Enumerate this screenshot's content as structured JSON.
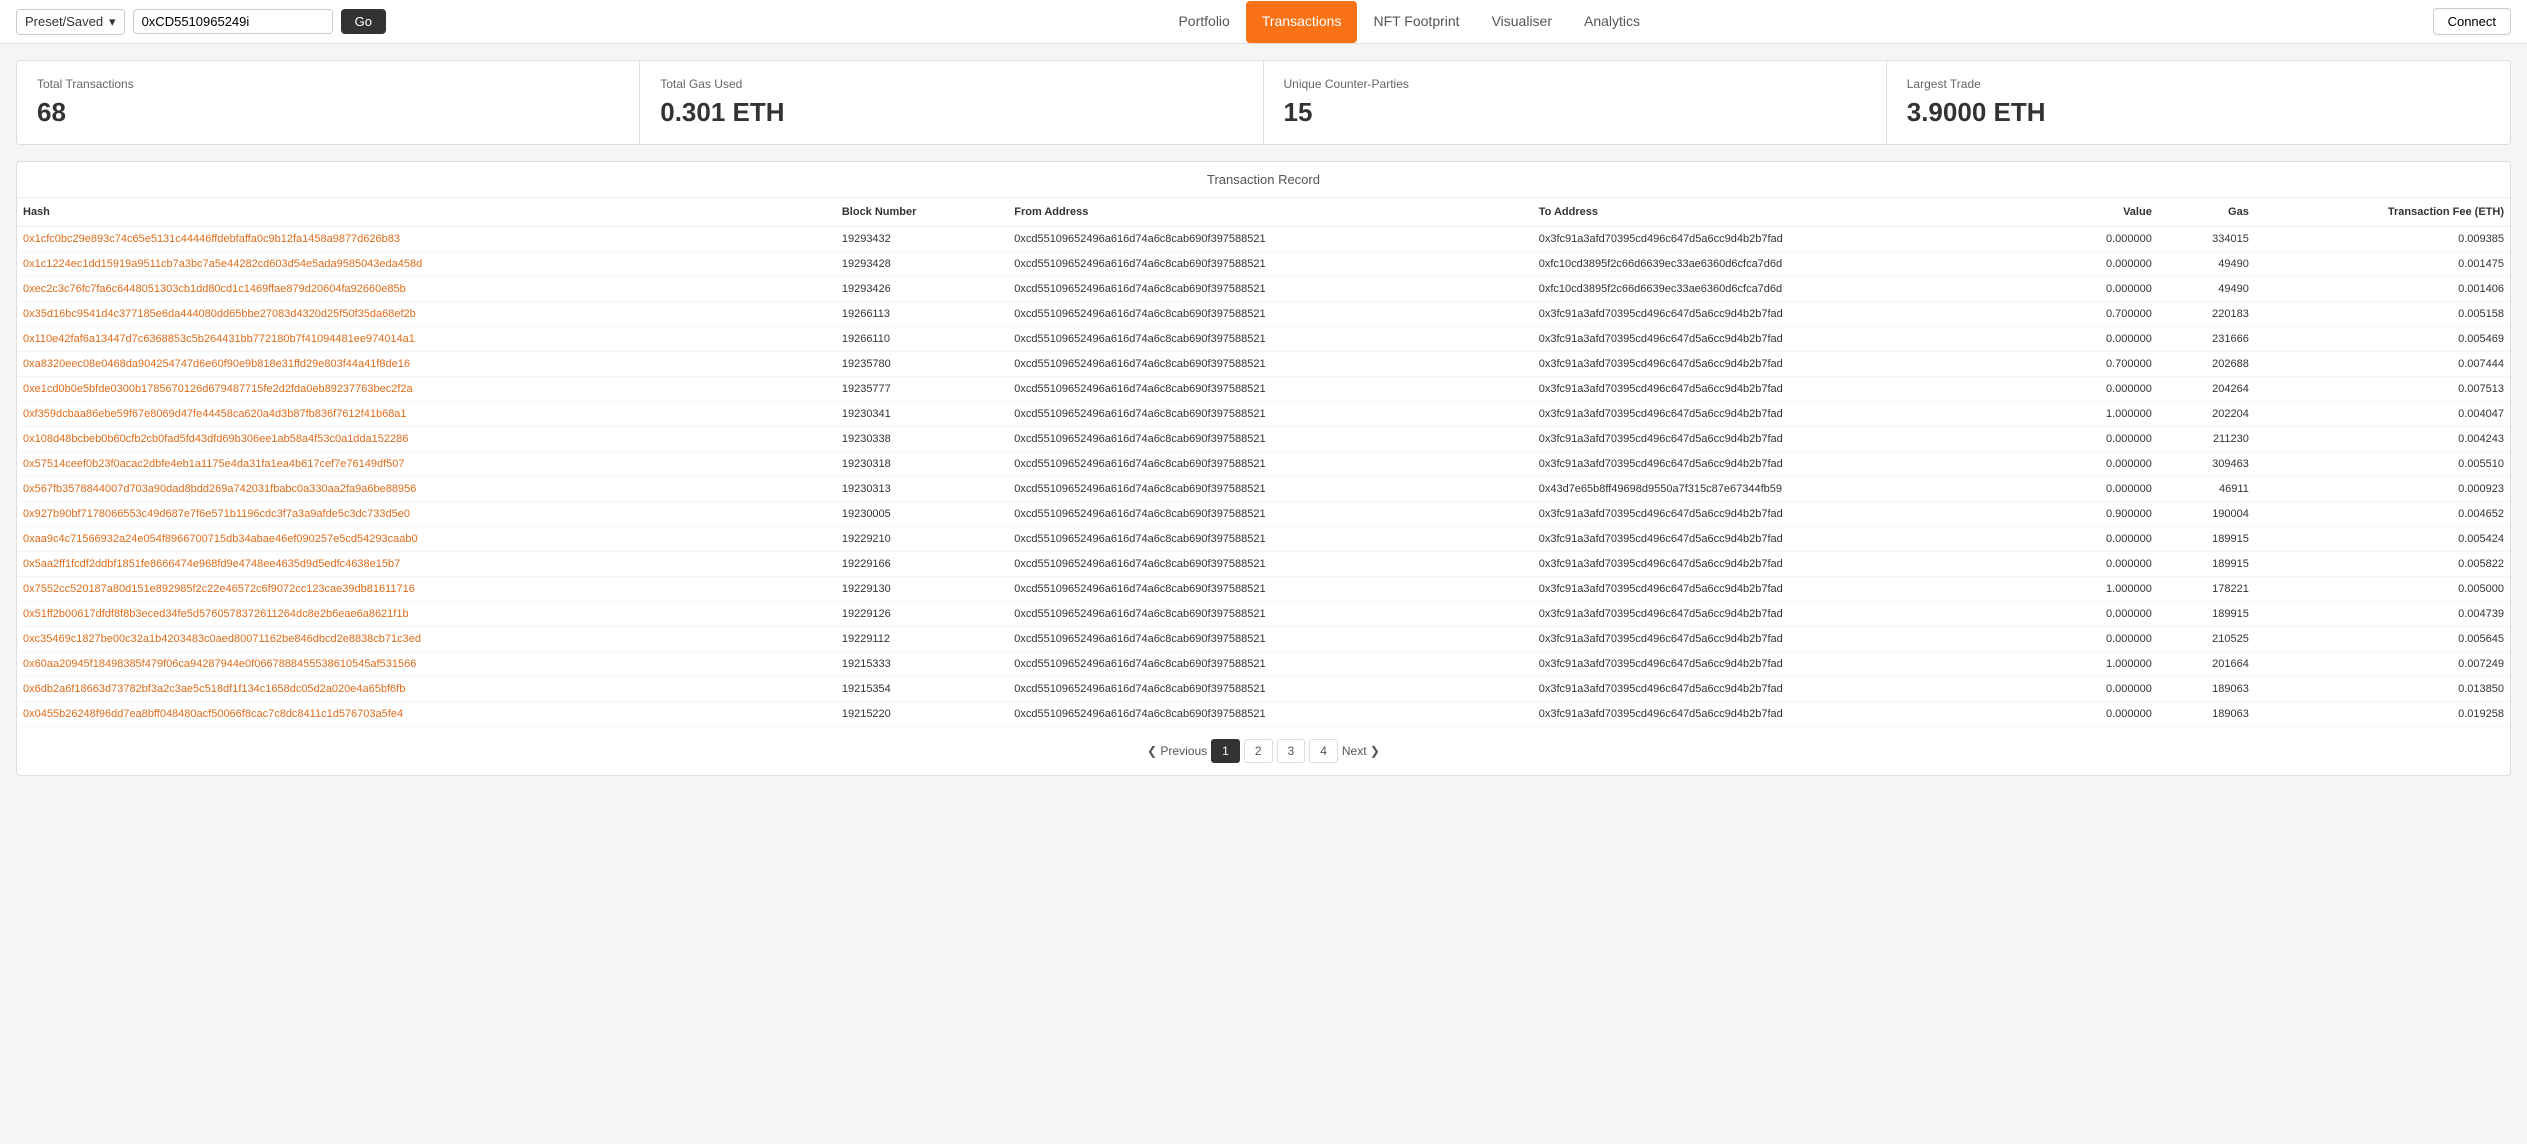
{
  "nav": {
    "preset_label": "Preset/Saved",
    "address_value": "0xCD5510965249i",
    "go_label": "Go",
    "tabs": [
      {
        "id": "portfolio",
        "label": "Portfolio",
        "active": false
      },
      {
        "id": "transactions",
        "label": "Transactions",
        "active": true
      },
      {
        "id": "nft-footprint",
        "label": "NFT Footprint",
        "active": false
      },
      {
        "id": "visualiser",
        "label": "Visualiser",
        "active": false
      },
      {
        "id": "analytics",
        "label": "Analytics",
        "active": false
      }
    ],
    "connect_label": "Connect"
  },
  "stats": [
    {
      "id": "total-transactions",
      "label": "Total Transactions",
      "value": "68"
    },
    {
      "id": "total-gas-used",
      "label": "Total Gas Used",
      "value": "0.301 ETH"
    },
    {
      "id": "unique-counter-parties",
      "label": "Unique Counter-Parties",
      "value": "15"
    },
    {
      "id": "largest-trade",
      "label": "Largest Trade",
      "value": "3.9000 ETH"
    }
  ],
  "table": {
    "title": "Transaction Record",
    "columns": [
      "Hash",
      "Block Number",
      "From Address",
      "To Address",
      "Value",
      "Gas",
      "Transaction Fee (ETH)"
    ],
    "rows": [
      {
        "hash": "0x1cfc0bc29e893c74c65e5131c44446ffdebfaffa0c9b12fa1458a9877d626b83",
        "block": "19293432",
        "from": "0xcd55109652496a616d74a6c8cab690f397588521",
        "to": "0x3fc91a3afd70395cd496c647d5a6cc9d4b2b7fad",
        "value": "0.000000",
        "gas": "334015",
        "fee": "0.009385"
      },
      {
        "hash": "0x1c1224ec1dd15919a9511cb7a3bc7a5e44282cd603d54e5ada9585043eda458d",
        "block": "19293428",
        "from": "0xcd55109652496a616d74a6c8cab690f397588521",
        "to": "0xfc10cd3895f2c66d6639ec33ae6360d6cfca7d6d",
        "value": "0.000000",
        "gas": "49490",
        "fee": "0.001475"
      },
      {
        "hash": "0xec2c3c76fc7fa6c6448051303cb1dd80cd1c1469ffae879d20604fa92660e85b",
        "block": "19293426",
        "from": "0xcd55109652496a616d74a6c8cab690f397588521",
        "to": "0xfc10cd3895f2c66d6639ec33ae6360d6cfca7d6d",
        "value": "0.000000",
        "gas": "49490",
        "fee": "0.001406"
      },
      {
        "hash": "0x35d16bc9541d4c377185e6da444080dd65bbe27083d4320d25f50f35da68ef2b",
        "block": "19266113",
        "from": "0xcd55109652496a616d74a6c8cab690f397588521",
        "to": "0x3fc91a3afd70395cd496c647d5a6cc9d4b2b7fad",
        "value": "0.700000",
        "gas": "220183",
        "fee": "0.005158"
      },
      {
        "hash": "0x110e42faf6a13447d7c6368853c5b264431bb772180b7f41094481ee974014a1",
        "block": "19266110",
        "from": "0xcd55109652496a616d74a6c8cab690f397588521",
        "to": "0x3fc91a3afd70395cd496c647d5a6cc9d4b2b7fad",
        "value": "0.000000",
        "gas": "231666",
        "fee": "0.005469"
      },
      {
        "hash": "0xa8320eec08e0468da904254747d6e60f90e9b818e31ffd29e803f44a41f8de16",
        "block": "19235780",
        "from": "0xcd55109652496a616d74a6c8cab690f397588521",
        "to": "0x3fc91a3afd70395cd496c647d5a6cc9d4b2b7fad",
        "value": "0.700000",
        "gas": "202688",
        "fee": "0.007444"
      },
      {
        "hash": "0xe1cd0b0e5bfde0300b1785670126d679487715fe2d2fda0eb89237763bec2f2a",
        "block": "19235777",
        "from": "0xcd55109652496a616d74a6c8cab690f397588521",
        "to": "0x3fc91a3afd70395cd496c647d5a6cc9d4b2b7fad",
        "value": "0.000000",
        "gas": "204264",
        "fee": "0.007513"
      },
      {
        "hash": "0xf359dcbaa86ebe59f67e8069d47fe44458ca620a4d3b87fb836f7612f41b68a1",
        "block": "19230341",
        "from": "0xcd55109652496a616d74a6c8cab690f397588521",
        "to": "0x3fc91a3afd70395cd496c647d5a6cc9d4b2b7fad",
        "value": "1.000000",
        "gas": "202204",
        "fee": "0.004047"
      },
      {
        "hash": "0x108d48bcbeb0b60cfb2cb0fad5fd43dfd69b306ee1ab58a4f53c0a1dda152286",
        "block": "19230338",
        "from": "0xcd55109652496a616d74a6c8cab690f397588521",
        "to": "0x3fc91a3afd70395cd496c647d5a6cc9d4b2b7fad",
        "value": "0.000000",
        "gas": "211230",
        "fee": "0.004243"
      },
      {
        "hash": "0x57514ceef0b23f0acac2dbfe4eb1a1175e4da31fa1ea4b617cef7e76149df507",
        "block": "19230318",
        "from": "0xcd55109652496a616d74a6c8cab690f397588521",
        "to": "0x3fc91a3afd70395cd496c647d5a6cc9d4b2b7fad",
        "value": "0.000000",
        "gas": "309463",
        "fee": "0.005510"
      },
      {
        "hash": "0x567fb3578844007d703a90dad8bdd269a742031fbabc0a330aa2fa9a6be88956",
        "block": "19230313",
        "from": "0xcd55109652496a616d74a6c8cab690f397588521",
        "to": "0x43d7e65b8ff49698d9550a7f315c87e67344fb59",
        "value": "0.000000",
        "gas": "46911",
        "fee": "0.000923"
      },
      {
        "hash": "0x927b90bf7178066553c49d687e7f6e571b1196cdc3f7a3a9afde5c3dc733d5e0",
        "block": "19230005",
        "from": "0xcd55109652496a616d74a6c8cab690f397588521",
        "to": "0x3fc91a3afd70395cd496c647d5a6cc9d4b2b7fad",
        "value": "0.900000",
        "gas": "190004",
        "fee": "0.004652"
      },
      {
        "hash": "0xaa9c4c71566932a24e054f8966700715db34abae46ef090257e5cd54293caab0",
        "block": "19229210",
        "from": "0xcd55109652496a616d74a6c8cab690f397588521",
        "to": "0x3fc91a3afd70395cd496c647d5a6cc9d4b2b7fad",
        "value": "0.000000",
        "gas": "189915",
        "fee": "0.005424"
      },
      {
        "hash": "0x5aa2ff1fcdf2ddbf1851fe8666474e968fd9e4748ee4635d9d5edfc4638e15b7",
        "block": "19229166",
        "from": "0xcd55109652496a616d74a6c8cab690f397588521",
        "to": "0x3fc91a3afd70395cd496c647d5a6cc9d4b2b7fad",
        "value": "0.000000",
        "gas": "189915",
        "fee": "0.005822"
      },
      {
        "hash": "0x7552cc520187a80d151e892985f2c22e46572c6f9072cc123cae39db81611716",
        "block": "19229130",
        "from": "0xcd55109652496a616d74a6c8cab690f397588521",
        "to": "0x3fc91a3afd70395cd496c647d5a6cc9d4b2b7fad",
        "value": "1.000000",
        "gas": "178221",
        "fee": "0.005000"
      },
      {
        "hash": "0x51ff2b00617dfdf8f8b3eced34fe5d5760578372611264dc8e2b6eae6a8621f1b",
        "block": "19229126",
        "from": "0xcd55109652496a616d74a6c8cab690f397588521",
        "to": "0x3fc91a3afd70395cd496c647d5a6cc9d4b2b7fad",
        "value": "0.000000",
        "gas": "189915",
        "fee": "0.004739"
      },
      {
        "hash": "0xc35469c1827be00c32a1b4203483c0aed80071162be846dbcd2e8838cb71c3ed",
        "block": "19229112",
        "from": "0xcd55109652496a616d74a6c8cab690f397588521",
        "to": "0x3fc91a3afd70395cd496c647d5a6cc9d4b2b7fad",
        "value": "0.000000",
        "gas": "210525",
        "fee": "0.005645"
      },
      {
        "hash": "0x60aa20945f18498385f479f06ca94287944e0f0667888455538610545af531566",
        "block": "19215333",
        "from": "0xcd55109652496a616d74a6c8cab690f397588521",
        "to": "0x3fc91a3afd70395cd496c647d5a6cc9d4b2b7fad",
        "value": "1.000000",
        "gas": "201664",
        "fee": "0.007249"
      },
      {
        "hash": "0x6db2a6f18663d73782bf3a2c3ae5c518df1f134c1658dc05d2a020e4a65bf6fb",
        "block": "19215354",
        "from": "0xcd55109652496a616d74a6c8cab690f397588521",
        "to": "0x3fc91a3afd70395cd496c647d5a6cc9d4b2b7fad",
        "value": "0.000000",
        "gas": "189063",
        "fee": "0.013850"
      },
      {
        "hash": "0x0455b26248f96dd7ea8bff048480acf50066f8cac7c8dc8411c1d576703a5fe4",
        "block": "19215220",
        "from": "0xcd55109652496a616d74a6c8cab690f397588521",
        "to": "0x3fc91a3afd70395cd496c647d5a6cc9d4b2b7fad",
        "value": "0.000000",
        "gas": "189063",
        "fee": "0.019258"
      }
    ]
  },
  "pagination": {
    "prev_label": "❮ Previous",
    "next_label": "Next ❯",
    "pages": [
      "1",
      "2",
      "3",
      "4"
    ],
    "current_page": "1"
  }
}
